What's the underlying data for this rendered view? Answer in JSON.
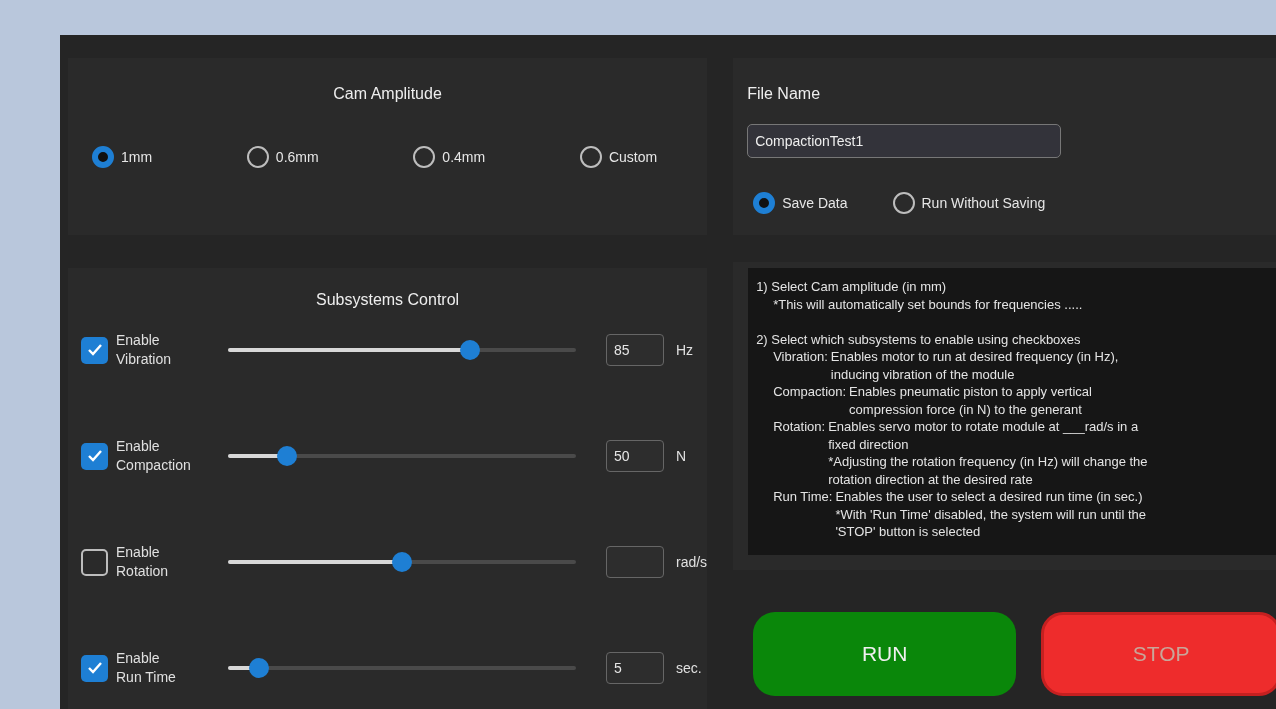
{
  "cam_amplitude": {
    "title": "Cam Amplitude",
    "options": [
      {
        "label": "1mm",
        "selected": true
      },
      {
        "label": "0.6mm",
        "selected": false
      },
      {
        "label": "0.4mm",
        "selected": false
      },
      {
        "label": "Custom",
        "selected": false
      }
    ]
  },
  "subsystems": {
    "title": "Subsystems Control",
    "rows": [
      {
        "label": "Enable\nVibration",
        "checked": true,
        "level": 0.695,
        "value": "85",
        "unit": "Hz"
      },
      {
        "label": "Enable\nCompaction",
        "checked": true,
        "level": 0.17,
        "value": "50",
        "unit": "N"
      },
      {
        "label": "Enable\nRotation",
        "checked": false,
        "level": 0.5,
        "unit": "rad/s"
      },
      {
        "label": "Enable\nRun Time",
        "checked": true,
        "level": 0.09,
        "value": "5",
        "unit": "sec."
      }
    ]
  },
  "file": {
    "label": "File Name",
    "value": "CompactionTest1",
    "options": [
      {
        "label": "Save Data",
        "selected": true
      },
      {
        "label": "Run Without Saving",
        "selected": false
      }
    ]
  },
  "instructions": [
    {
      "title": "1) Select Cam amplitude (in mm)",
      "note": "*This will automatically set bounds for frequencies ....."
    },
    {
      "title": "2) Select which subsystems to enable using checkboxes",
      "items": [
        {
          "label": "Vibration:",
          "text": "Enables motor to run at desired frequency (in Hz),\ninducing vibration of the module"
        },
        {
          "label": "Compaction:",
          "text": "Enables pneumatic piston to apply vertical\ncompression force (in N) to the generant"
        },
        {
          "label": "Rotation:",
          "text": "Enables servo motor to rotate module at ___rad/s in a\nfixed direction\n*Adjusting the rotation frequency (in Hz) will change the\nrotation direction at the desired rate"
        },
        {
          "label": "Run Time:",
          "text": "Enables the user to select a desired run time (in sec.)\n*With 'Run Time' disabled, the system will run until the\n'STOP' button is selected"
        }
      ]
    }
  ],
  "buttons": [
    {
      "label": "RUN",
      "kind": "run",
      "disabled": false
    },
    {
      "label": "STOP",
      "kind": "stop",
      "disabled": true
    }
  ]
}
